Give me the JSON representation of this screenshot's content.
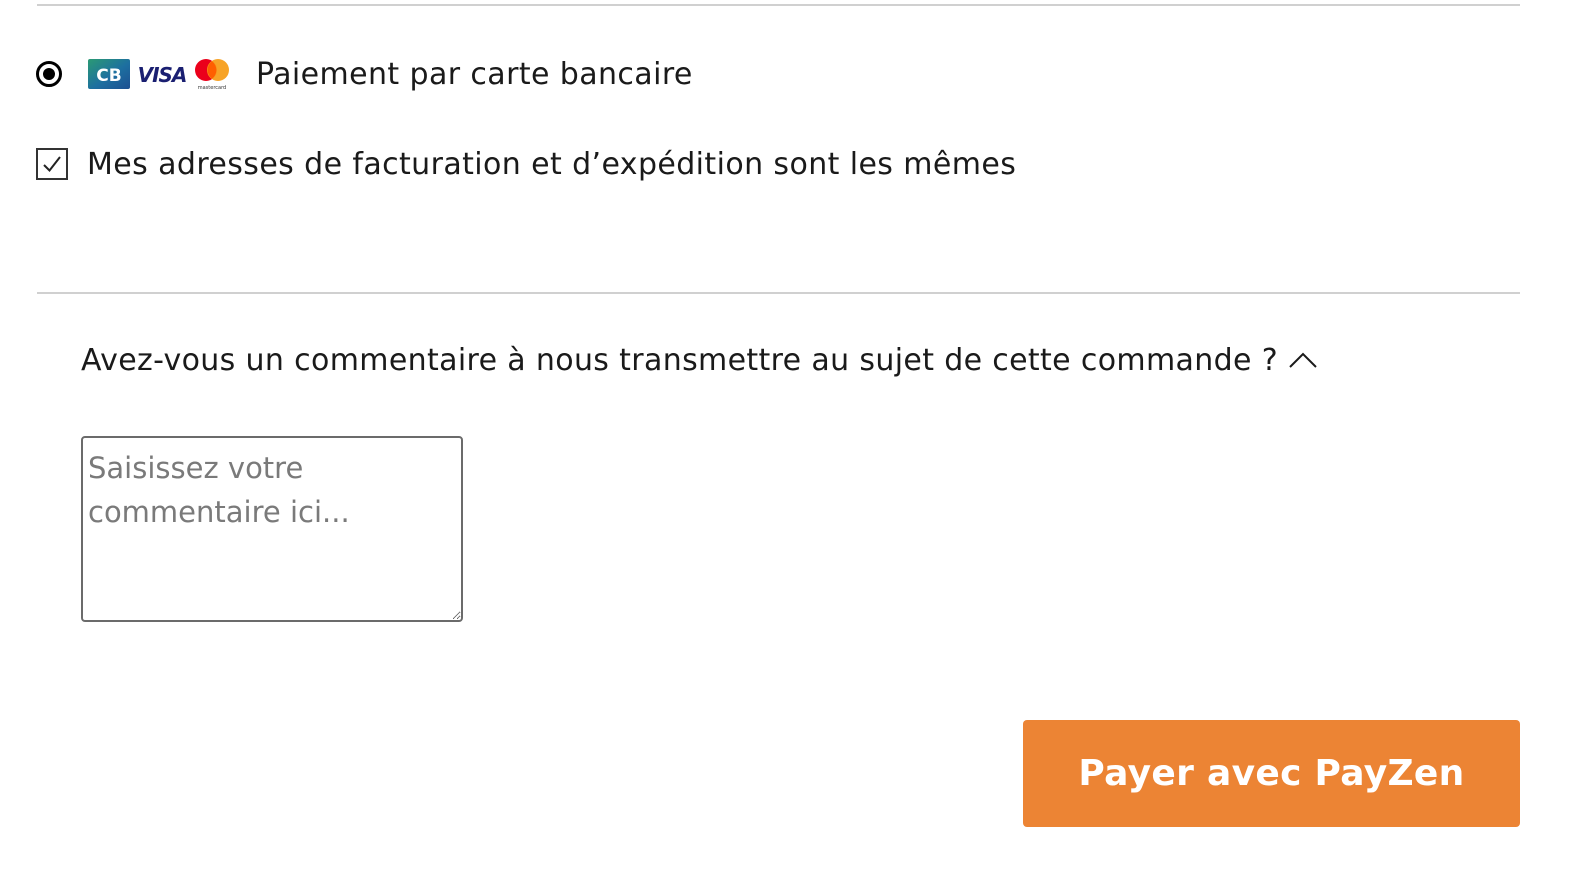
{
  "payment": {
    "label": "Paiement par carte bancaire",
    "selected": true,
    "logos": {
      "cb": "CB",
      "visa": "VISA",
      "mastercard": "mastercard"
    }
  },
  "same_address": {
    "label": "Mes adresses de facturation et d’expédition sont les mêmes",
    "checked": true
  },
  "comment": {
    "question": "Avez-vous un commentaire à nous transmettre au sujet de cette commande ?",
    "placeholder": "Saisissez votre commentaire ici...",
    "value": "",
    "expanded": true
  },
  "submit": {
    "label": "Payer avec PayZen"
  },
  "colors": {
    "accent": "#ec8434",
    "divider": "#d0d0d0",
    "text": "#1a1a1a",
    "cb_blue": "#1d4f91",
    "cb_green": "#2b9a74",
    "visa_blue": "#1a1f71",
    "mc_red": "#eb001b",
    "mc_orange": "#f79e1b"
  },
  "icons": {
    "radio": "radio-selected-icon",
    "checkbox": "checkmark-icon",
    "chevron": "chevron-up-icon"
  }
}
